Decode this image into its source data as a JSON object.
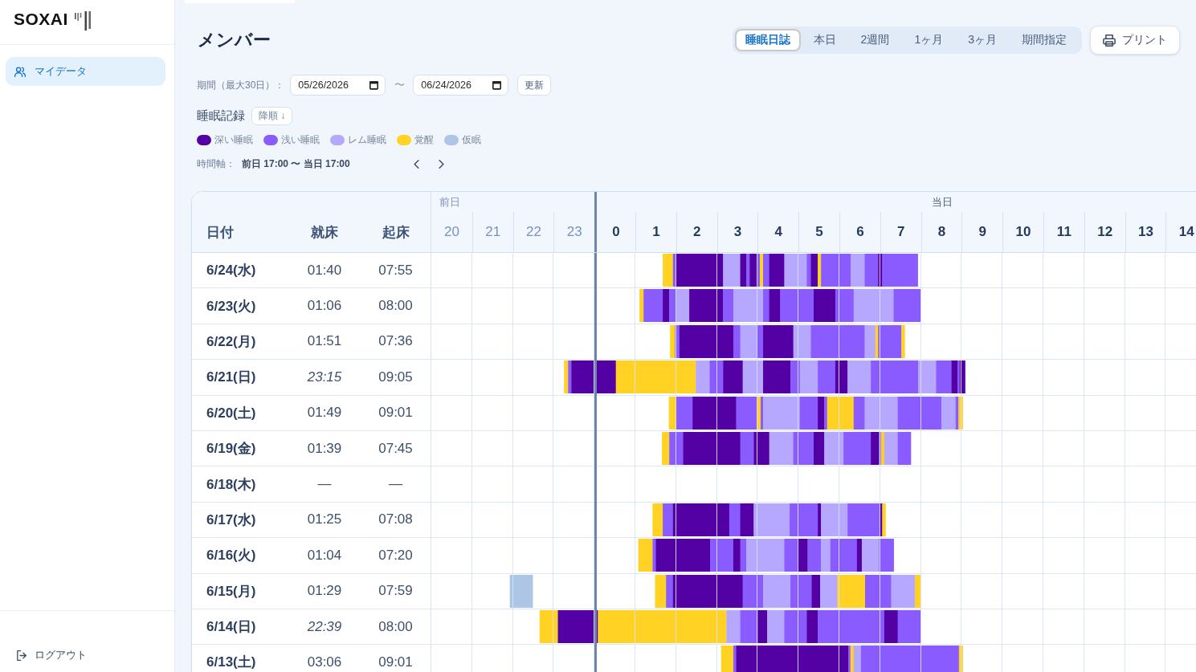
{
  "sidebar": {
    "logo": "SOXAI",
    "items": [
      {
        "label": "マイデータ",
        "selected": true
      }
    ],
    "logout": "ログアウト"
  },
  "header": {
    "title": "メンバー",
    "views": [
      {
        "label": "睡眠日誌",
        "selected": true
      },
      {
        "label": "本日",
        "selected": false
      },
      {
        "label": "2週間",
        "selected": false
      },
      {
        "label": "1ヶ月",
        "selected": false
      },
      {
        "label": "3ヶ月",
        "selected": false
      },
      {
        "label": "期間指定",
        "selected": false
      }
    ],
    "print": "プリント"
  },
  "filter": {
    "label": "期間（最大30日）：",
    "start": "05/26/2026",
    "separator": "〜",
    "end": "06/24/2026",
    "update": "更新"
  },
  "records": {
    "title": "睡眠記録",
    "sort": "降順 ↓",
    "legend": [
      {
        "label": "深い睡眠",
        "color": "#5300a4"
      },
      {
        "label": "浅い睡眠",
        "color": "#8a5cff"
      },
      {
        "label": "レム睡眠",
        "color": "#b7a8ff"
      },
      {
        "label": "覚醒",
        "color": "#ffd224"
      },
      {
        "label": "仮眠",
        "color": "#aec6e6"
      }
    ],
    "axis_label": "時間軸：",
    "axis_range": "前日 17:00 〜 当日 17:00"
  },
  "table": {
    "columns": [
      "日付",
      "就床",
      "起床"
    ],
    "day_groups": [
      "前日",
      "当日"
    ],
    "hours": [
      {
        "label": "20",
        "previous_day": true
      },
      {
        "label": "21",
        "previous_day": true
      },
      {
        "label": "22",
        "previous_day": true
      },
      {
        "label": "23",
        "previous_day": true
      },
      {
        "label": "0",
        "previous_day": false
      },
      {
        "label": "1",
        "previous_day": false
      },
      {
        "label": "2",
        "previous_day": false
      },
      {
        "label": "3",
        "previous_day": false
      },
      {
        "label": "4",
        "previous_day": false
      },
      {
        "label": "5",
        "previous_day": false
      },
      {
        "label": "6",
        "previous_day": false
      },
      {
        "label": "7",
        "previous_day": false
      },
      {
        "label": "8",
        "previous_day": false
      },
      {
        "label": "9",
        "previous_day": false
      },
      {
        "label": "10",
        "previous_day": false
      },
      {
        "label": "11",
        "previous_day": false
      },
      {
        "label": "12",
        "previous_day": false
      },
      {
        "label": "13",
        "previous_day": false
      },
      {
        "label": "14",
        "previous_day": false
      }
    ],
    "rows": [
      {
        "date": "6/24(水)",
        "bedtime": "01:40",
        "wake": "07:55",
        "bedtime_previous_day": false
      },
      {
        "date": "6/23(火)",
        "bedtime": "01:06",
        "wake": "08:00",
        "bedtime_previous_day": false
      },
      {
        "date": "6/22(月)",
        "bedtime": "01:51",
        "wake": "07:36",
        "bedtime_previous_day": false
      },
      {
        "date": "6/21(日)",
        "bedtime": "23:15",
        "wake": "09:05",
        "bedtime_previous_day": true
      },
      {
        "date": "6/20(土)",
        "bedtime": "01:49",
        "wake": "09:01",
        "bedtime_previous_day": false
      },
      {
        "date": "6/19(金)",
        "bedtime": "01:39",
        "wake": "07:45",
        "bedtime_previous_day": false
      },
      {
        "date": "6/18(木)",
        "bedtime": "—",
        "wake": "—",
        "bedtime_previous_day": false
      },
      {
        "date": "6/17(水)",
        "bedtime": "01:25",
        "wake": "07:08",
        "bedtime_previous_day": false
      },
      {
        "date": "6/16(火)",
        "bedtime": "01:04",
        "wake": "07:20",
        "bedtime_previous_day": false
      },
      {
        "date": "6/15(月)",
        "bedtime": "01:29",
        "wake": "07:59",
        "bedtime_previous_day": false
      },
      {
        "date": "6/14(日)",
        "bedtime": "22:39",
        "wake": "08:00",
        "bedtime_previous_day": true
      },
      {
        "date": "6/13(土)",
        "bedtime": "03:06",
        "wake": "09:01",
        "bedtime_previous_day": false
      }
    ]
  }
}
